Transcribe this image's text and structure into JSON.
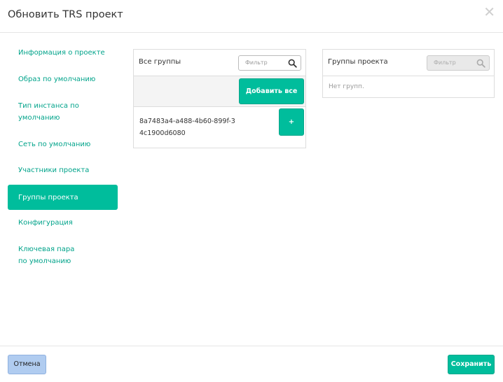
{
  "modal": {
    "title": "Обновить TRS проект",
    "close_glyph": "✕"
  },
  "nav": {
    "items": [
      {
        "label": "Информация о проекте"
      },
      {
        "label": "Образ по умолчанию"
      },
      {
        "label": "Тип инстанса по умолчанию"
      },
      {
        "label": "Сеть по умолчанию"
      },
      {
        "label": "Участники проекта"
      },
      {
        "label": "Группы проекта",
        "active": true
      },
      {
        "label": "Конфигурация"
      },
      {
        "label": "Ключевая пара по умолчанию"
      }
    ]
  },
  "all_groups": {
    "title": "Все группы",
    "filter_placeholder": "Фильтр",
    "add_all_label": "Добавить все",
    "items": [
      {
        "id": "8a7483a4-a488-4b60-899f-34c1900d6080",
        "add_label": "+"
      }
    ]
  },
  "project_groups": {
    "title": "Группы проекта",
    "filter_placeholder": "Фильтр",
    "empty_text": "Нет групп."
  },
  "footer": {
    "cancel_label": "Отмена",
    "save_label": "Сохранить"
  },
  "colors": {
    "accent": "#00bd9c",
    "link": "#00a38a",
    "cancel_bg": "#b0ccf0"
  }
}
